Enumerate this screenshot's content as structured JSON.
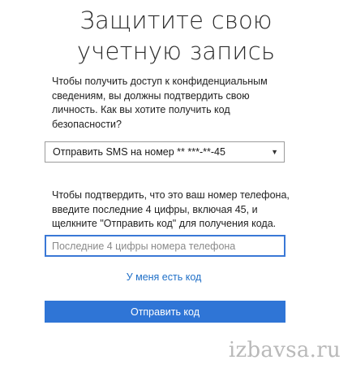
{
  "title": {
    "line1": "Защитите свою",
    "line2": "учетную запись"
  },
  "intro": {
    "line1": "Чтобы получить доступ к конфиденциальным",
    "line2": "сведениям, вы должны подтвердить свою",
    "line3": "личность. Как вы хотите получить код",
    "line4": "безопасности?"
  },
  "method_select": {
    "selected": "Отправить SMS на номер ** ***-**-45",
    "arrow": "▼"
  },
  "instructions": {
    "line1": "Чтобы подтвердить, что это ваш номер телефона,",
    "line2": "введите последние 4 цифры, включая 45, и",
    "line3": "щелкните \"Отправить код\" для получения кода."
  },
  "phone_input": {
    "value": "",
    "placeholder": "Последние 4 цифры номера телефона"
  },
  "have_code_link": "У меня есть код",
  "submit_button": "Отправить код",
  "watermark": "izbavsa.ru",
  "colors": {
    "accent": "#2f75d6",
    "link": "#1f6fc7",
    "input_border": "#3a78d6"
  }
}
